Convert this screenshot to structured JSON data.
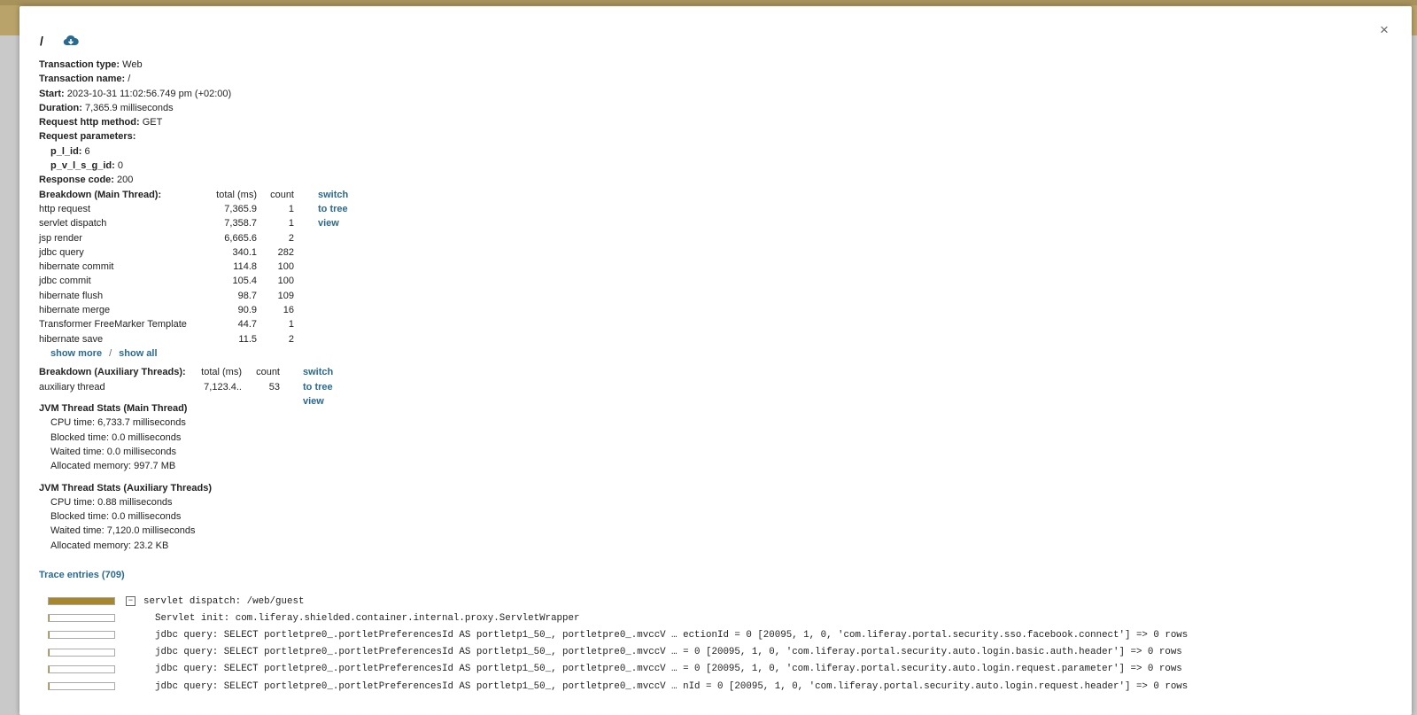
{
  "modal": {
    "close_label": "×",
    "header_title": "/"
  },
  "info": {
    "transaction_type_label": "Transaction type:",
    "transaction_type_value": "Web",
    "transaction_name_label": "Transaction name:",
    "transaction_name_value": "/",
    "start_label": "Start:",
    "start_value": "2023-10-31 11:02:56.749 pm (+02:00)",
    "duration_label": "Duration:",
    "duration_value": "7,365.9 milliseconds",
    "method_label": "Request http method:",
    "method_value": "GET",
    "params_label": "Request parameters:",
    "params": [
      {
        "name": "p_l_id:",
        "value": "6"
      },
      {
        "name": "p_v_l_s_g_id:",
        "value": "0"
      }
    ],
    "response_label": "Response code:",
    "response_value": "200"
  },
  "main_breakdown": {
    "title": "Breakdown (Main Thread):",
    "col_total": "total (ms)",
    "col_count": "count",
    "switch_label": "switch to tree view",
    "rows": [
      {
        "name": "http request",
        "total": "7,365.9",
        "count": "1"
      },
      {
        "name": "servlet dispatch",
        "total": "7,358.7",
        "count": "1"
      },
      {
        "name": "jsp render",
        "total": "6,665.6",
        "count": "2"
      },
      {
        "name": "jdbc query",
        "total": "340.1",
        "count": "282"
      },
      {
        "name": "hibernate commit",
        "total": "114.8",
        "count": "100"
      },
      {
        "name": "jdbc commit",
        "total": "105.4",
        "count": "100"
      },
      {
        "name": "hibernate flush",
        "total": "98.7",
        "count": "109"
      },
      {
        "name": "hibernate merge",
        "total": "90.9",
        "count": "16"
      },
      {
        "name": "Transformer FreeMarker Template",
        "total": "44.7",
        "count": "1"
      },
      {
        "name": "hibernate save",
        "total": "11.5",
        "count": "2"
      }
    ],
    "show_more": "show more",
    "separator": "/",
    "show_all": "show all"
  },
  "aux_breakdown": {
    "title": "Breakdown (Auxiliary Threads):",
    "col_total": "total (ms)",
    "col_count": "count",
    "switch_label": "switch to tree view",
    "rows": [
      {
        "name": "auxiliary thread",
        "total": "7,123.4..",
        "count": "53"
      }
    ]
  },
  "jvm_main": {
    "title": "JVM Thread Stats (Main Thread)",
    "cpu": "CPU time: 6,733.7 milliseconds",
    "blocked": "Blocked time: 0.0 milliseconds",
    "waited": "Waited time: 0.0 milliseconds",
    "memory": "Allocated memory: 997.7 MB"
  },
  "jvm_aux": {
    "title": "JVM Thread Stats (Auxiliary Threads)",
    "cpu": "CPU time: 0.88 milliseconds",
    "blocked": "Blocked time: 0.0 milliseconds",
    "waited": "Waited time: 7,120.0 milliseconds",
    "memory": "Allocated memory: 23.2 KB"
  },
  "trace": {
    "title": "Trace entries (709)",
    "entries": [
      {
        "text": "servlet dispatch: /web/guest",
        "toggle": "−",
        "fill_fraction": 1.0
      },
      {
        "text": "Servlet init: com.liferay.shielded.container.internal.proxy.ServletWrapper",
        "fill_fraction": 0.02
      },
      {
        "text": "jdbc query: SELECT portletpre0_.portletPreferencesId AS portletp1_50_, portletpre0_.mvccV … ectionId = 0 [20095, 1, 0, 'com.liferay.portal.security.sso.facebook.connect'] => 0 rows",
        "fill_fraction": 0.02
      },
      {
        "text": "jdbc query: SELECT portletpre0_.portletPreferencesId AS portletp1_50_, portletpre0_.mvccV …  = 0 [20095, 1, 0, 'com.liferay.portal.security.auto.login.basic.auth.header'] => 0 rows",
        "fill_fraction": 0.02
      },
      {
        "text": "jdbc query: SELECT portletpre0_.portletPreferencesId AS portletp1_50_, portletpre0_.mvccV …  = 0 [20095, 1, 0, 'com.liferay.portal.security.auto.login.request.parameter'] => 0 rows",
        "fill_fraction": 0.02
      },
      {
        "text": "jdbc query: SELECT portletpre0_.portletPreferencesId AS portletp1_50_, portletpre0_.mvccV … nId = 0 [20095, 1, 0, 'com.liferay.portal.security.auto.login.request.header'] => 0 rows",
        "fill_fraction": 0.02
      }
    ]
  },
  "colors": {
    "link": "#2b6a90",
    "bar_fill": "#a8862a",
    "header_band": "#b9a36a"
  },
  "icons": {
    "download": "cloud-download-icon",
    "collapse": "collapse-icon",
    "close": "close-icon"
  }
}
